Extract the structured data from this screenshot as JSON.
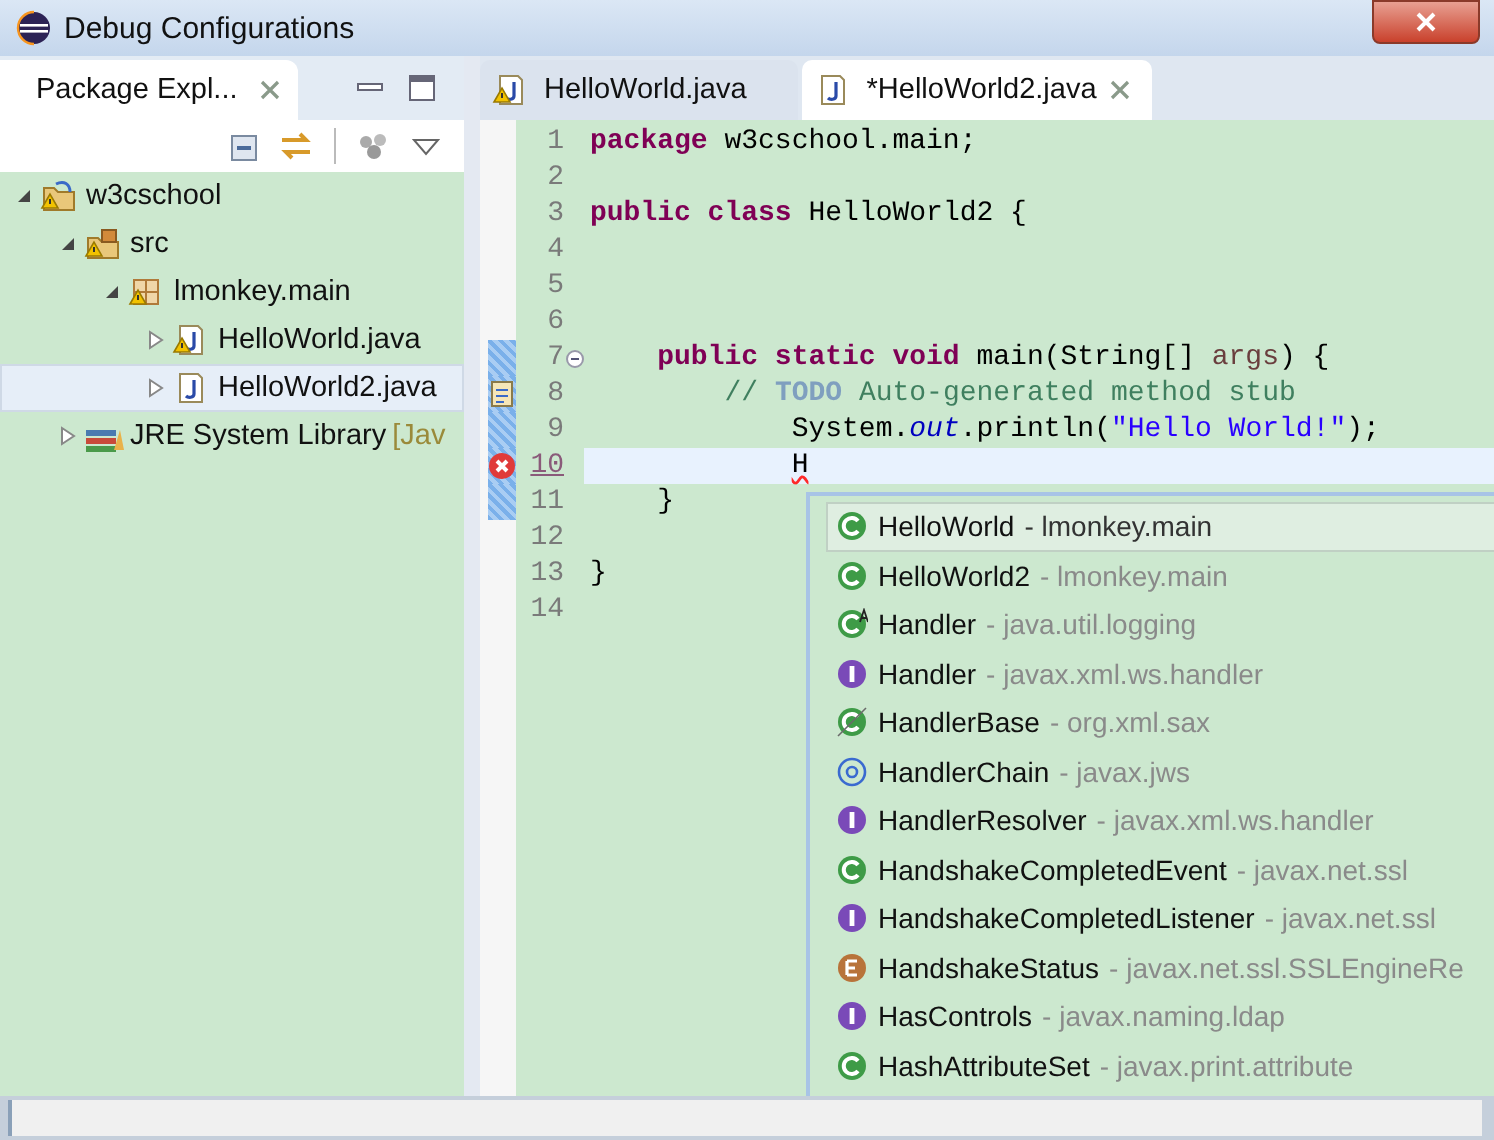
{
  "window": {
    "title": "Debug Configurations"
  },
  "explorer": {
    "tab": {
      "label": "Package Expl...",
      "selected": true
    },
    "tree": [
      {
        "label": "w3cschool",
        "kind": "project",
        "warning": true,
        "expanded": true,
        "selected": false,
        "children": [
          {
            "label": "src",
            "kind": "source-folder",
            "warning": true,
            "expanded": true,
            "selected": false,
            "children": [
              {
                "label": "lmonkey.main",
                "kind": "package",
                "warning": true,
                "expanded": true,
                "selected": false,
                "children": [
                  {
                    "label": "HelloWorld.java",
                    "kind": "java-file",
                    "warning": true,
                    "expanded": false,
                    "selected": false
                  },
                  {
                    "label": "HelloWorld2.java",
                    "kind": "java-file",
                    "warning": false,
                    "expanded": false,
                    "selected": true
                  }
                ]
              }
            ]
          },
          {
            "label": "JRE System Library",
            "decoration": "[Jav",
            "kind": "library",
            "warning": false,
            "expanded": false,
            "selected": false
          }
        ]
      }
    ]
  },
  "editor": {
    "tabs": [
      {
        "label": "HelloWorld.java",
        "selected": false,
        "warning": true
      },
      {
        "label": "*HelloWorld2.java",
        "selected": true,
        "warning": false
      }
    ],
    "lines": [
      {
        "number": "1",
        "kind": "plain",
        "current": false,
        "in_range": false,
        "segments": [
          {
            "kind": "keyword",
            "text": "package"
          },
          {
            "kind": "plain",
            "text": " w3cschool.main;"
          }
        ]
      },
      {
        "number": "2",
        "kind": "plain",
        "current": false,
        "in_range": false
      },
      {
        "number": "3",
        "kind": "plain",
        "current": false,
        "in_range": false,
        "segments": [
          {
            "kind": "keyword",
            "text": "public class"
          },
          {
            "kind": "plain",
            "text": " HelloWorld2 {"
          }
        ]
      },
      {
        "number": "4",
        "kind": "plain",
        "current": false,
        "in_range": false
      },
      {
        "number": "5",
        "kind": "plain",
        "current": false,
        "in_range": false
      },
      {
        "number": "6",
        "kind": "plain",
        "current": false,
        "in_range": false
      },
      {
        "number": "7",
        "kind": "fold",
        "current": false,
        "in_range": true,
        "segments": [
          {
            "kind": "keyword",
            "text": "    public static void"
          },
          {
            "kind": "plain",
            "text": " main(String[] "
          },
          {
            "kind": "parameter",
            "text": "args"
          },
          {
            "kind": "plain",
            "text": ") {"
          }
        ]
      },
      {
        "number": "8",
        "kind": "task",
        "current": false,
        "in_range": true,
        "segments": [
          {
            "kind": "comment",
            "text": "        // "
          },
          {
            "kind": "todo",
            "text": "TODO"
          },
          {
            "kind": "comment",
            "text": " Auto-generated method stub"
          }
        ]
      },
      {
        "number": "9",
        "kind": "plain",
        "current": false,
        "in_range": true,
        "segments": [
          {
            "kind": "plain",
            "text": "            System."
          },
          {
            "kind": "static-field",
            "text": "out"
          },
          {
            "kind": "plain",
            "text": ".println("
          },
          {
            "kind": "string",
            "text": "\"Hello World!\""
          },
          {
            "kind": "plain",
            "text": ");"
          }
        ]
      },
      {
        "number": "10",
        "kind": "error",
        "current": true,
        "in_range": true,
        "segments": [
          {
            "kind": "error",
            "text": "            H"
          }
        ]
      },
      {
        "number": "11",
        "kind": "plain",
        "current": false,
        "in_range": true,
        "segments": [
          {
            "kind": "plain",
            "text": "    }"
          }
        ]
      },
      {
        "number": "12",
        "kind": "plain",
        "current": false,
        "in_range": false
      },
      {
        "number": "13",
        "kind": "plain",
        "current": false,
        "in_range": false,
        "segments": [
          {
            "kind": "plain",
            "text": "}"
          }
        ]
      },
      {
        "number": "14",
        "kind": "plain",
        "current": false,
        "in_range": false
      }
    ]
  },
  "completion": {
    "items": [
      {
        "kind": "class",
        "name": "HelloWorld",
        "package": "- lmonkey.main",
        "selected": true
      },
      {
        "kind": "class",
        "name": "HelloWorld2",
        "package": "- lmonkey.main",
        "selected": false
      },
      {
        "kind": "abstract-class",
        "name": "Handler",
        "package": "- java.util.logging",
        "selected": false
      },
      {
        "kind": "interface",
        "name": "Handler",
        "package": "- javax.xml.ws.handler",
        "selected": false
      },
      {
        "kind": "deprecated-class",
        "name": "HandlerBase",
        "package": "- org.xml.sax",
        "selected": false
      },
      {
        "kind": "annotation",
        "name": "HandlerChain",
        "package": "- javax.jws",
        "selected": false
      },
      {
        "kind": "interface",
        "name": "HandlerResolver",
        "package": "- javax.xml.ws.handler",
        "selected": false
      },
      {
        "kind": "class",
        "name": "HandshakeCompletedEvent",
        "package": "- javax.net.ssl",
        "selected": false
      },
      {
        "kind": "interface",
        "name": "HandshakeCompletedListener",
        "package": "- javax.net.ssl",
        "selected": false
      },
      {
        "kind": "enum",
        "name": "HandshakeStatus",
        "package": "- javax.net.ssl.SSLEngineRe",
        "selected": false
      },
      {
        "kind": "interface",
        "name": "HasControls",
        "package": "- javax.naming.ldap",
        "selected": false
      },
      {
        "kind": "class",
        "name": "HashAttributeSet",
        "package": "- javax.print.attribute",
        "selected": false
      }
    ]
  }
}
